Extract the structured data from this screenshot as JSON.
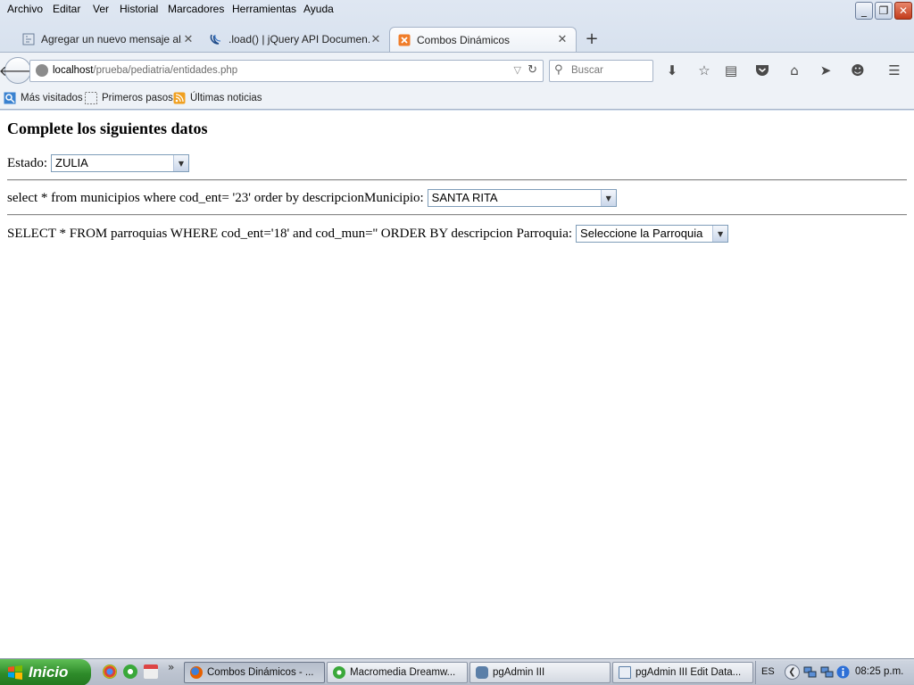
{
  "menubar": {
    "items": [
      "Archivo",
      "Editar",
      "Ver",
      "Historial",
      "Marcadores",
      "Herramientas",
      "Ayuda"
    ]
  },
  "window_controls": {
    "minimize": "_",
    "restore": "❐",
    "close": "✕"
  },
  "tabs": [
    {
      "label": "Agregar un nuevo mensaje al...",
      "icon": "page-icon",
      "active": false
    },
    {
      "label": ".load() | jQuery API Documen...",
      "icon": "jquery-icon",
      "active": false
    },
    {
      "label": "Combos Dinámicos",
      "icon": "xampp-icon",
      "active": true
    }
  ],
  "new_tab_symbol": "+",
  "navbar": {
    "url_host": "localhost",
    "url_path": "/prueba/pediatria/entidades.php",
    "search_placeholder": "Buscar"
  },
  "toolbar_icons": [
    "download-icon",
    "bookmark-star-icon",
    "reading-list-icon",
    "pocket-icon",
    "home-icon",
    "send-icon",
    "hello-icon",
    "menu-icon"
  ],
  "bookmarks": [
    {
      "label": "Más visitados",
      "icon": "most-visited-icon"
    },
    {
      "label": "Primeros pasos",
      "icon": "blank-page-icon"
    },
    {
      "label": "Últimas noticias",
      "icon": "rss-icon"
    }
  ],
  "page": {
    "title": "Complete los siguientes datos",
    "estado": {
      "label": "Estado:",
      "selected": "ZULIA"
    },
    "municipio": {
      "sql_text": "select * from municipios where cod_ent= '23' order by descripcion",
      "label": "Municipio:",
      "selected": "SANTA RITA"
    },
    "parroquia": {
      "sql_text": "SELECT * FROM parroquias WHERE cod_ent='18' and cod_mun='' ORDER BY descripcion",
      "label": "Parroquia:",
      "selected": "Seleccione la Parroquia"
    }
  },
  "taskbar": {
    "start_label": "Inicio",
    "quick_launch": [
      "chrome-icon",
      "dreamweaver-icon",
      "calendar-icon"
    ],
    "more_symbol": "»",
    "tasks": [
      {
        "label": "Combos Dinámicos - ...",
        "icon": "firefox-icon",
        "active": true
      },
      {
        "label": "Macromedia Dreamw...",
        "icon": "dreamweaver-icon",
        "active": false
      },
      {
        "label": "pgAdmin III",
        "icon": "pgadmin-icon",
        "active": false
      },
      {
        "label": "pgAdmin III Edit Data...",
        "icon": "edit-data-icon",
        "active": false
      }
    ],
    "language": "ES",
    "clock": "08:25 p.m."
  },
  "colors": {
    "chrome_bg": "#cfdbea",
    "start_green": "#2e8b2a",
    "close_red": "#c23c1c"
  }
}
